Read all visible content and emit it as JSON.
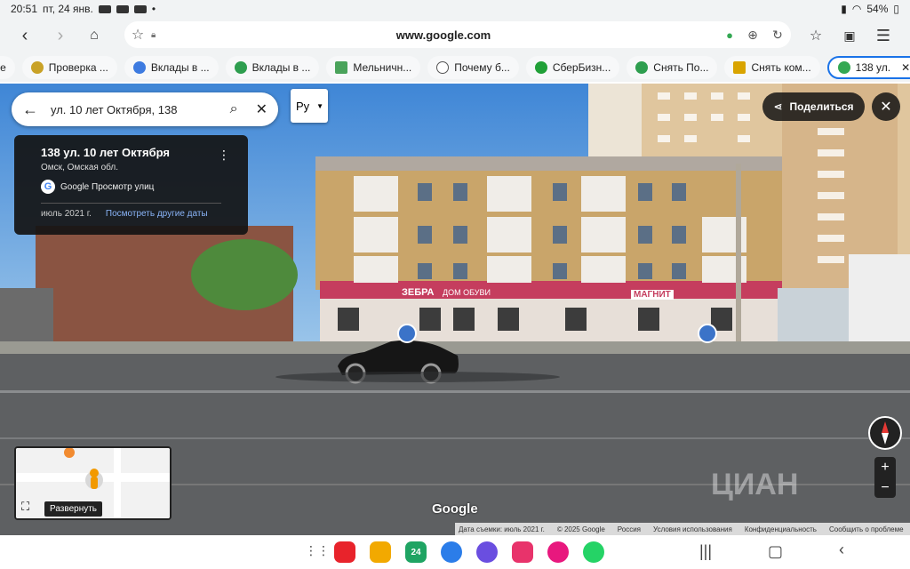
{
  "status": {
    "time": "20:51",
    "date": "пт, 24 янв.",
    "battery": "54%"
  },
  "toolbar": {
    "url": "www.google.com"
  },
  "tabs": [
    {
      "label": "ге",
      "color": "#888"
    },
    {
      "label": "Проверка ...",
      "color": "#c9a227"
    },
    {
      "label": "Вклады в ...",
      "color": "#3d7be0"
    },
    {
      "label": "Вклады в ...",
      "color": "#2e9e4f"
    },
    {
      "label": "Мельничн...",
      "color": "#4aa35b"
    },
    {
      "label": "Почему б...",
      "color": "#777"
    },
    {
      "label": "СберБизн...",
      "color": "#21a038"
    },
    {
      "label": "Снять По...",
      "color": "#2e9e4f"
    },
    {
      "label": "Снять ком...",
      "color": "#d9a400"
    },
    {
      "label": "138 ул.",
      "color": "#34a853",
      "active": true
    }
  ],
  "streetview": {
    "search_query": "ул. 10 лет Октября, 138",
    "lang": "Ру",
    "card_title": "138 ул. 10 лет Октября",
    "card_subtitle": "Омск, Омская обл.",
    "card_source": "Google Просмотр улиц",
    "card_date": "июль 2021 г.",
    "card_other_dates": "Посмотреть другие даты",
    "share_label": "Поделиться",
    "expand_label": "Развернуть",
    "logo": "Google",
    "sign_zebra": "ЗЕБРА",
    "sign_shoes": "ДОМ ОБУВИ",
    "sign_magnit": "МАГНИТ",
    "watermark": "ЦИАН"
  },
  "footer": {
    "date": "Дата съемки: июль 2021 г.",
    "copyright": "© 2025 Google",
    "country": "Россия",
    "terms": "Условия использования",
    "privacy": "Конфиденциальность",
    "report": "Сообщить о проблеме"
  },
  "apps": [
    {
      "name": "flipboard",
      "color": "#e8232b",
      "label": ""
    },
    {
      "name": "folder",
      "color": "#f2a900",
      "label": ""
    },
    {
      "name": "calendar",
      "color": "#1fa463",
      "label": "24"
    },
    {
      "name": "messages",
      "color": "#2b7de9",
      "label": ""
    },
    {
      "name": "samsung-internet",
      "color": "#6a4ee0",
      "label": ""
    },
    {
      "name": "screen-recorder",
      "color": "#e8336b",
      "label": ""
    },
    {
      "name": "blossom",
      "color": "#e8187e",
      "label": ""
    },
    {
      "name": "whatsapp",
      "color": "#25d366",
      "label": ""
    }
  ]
}
